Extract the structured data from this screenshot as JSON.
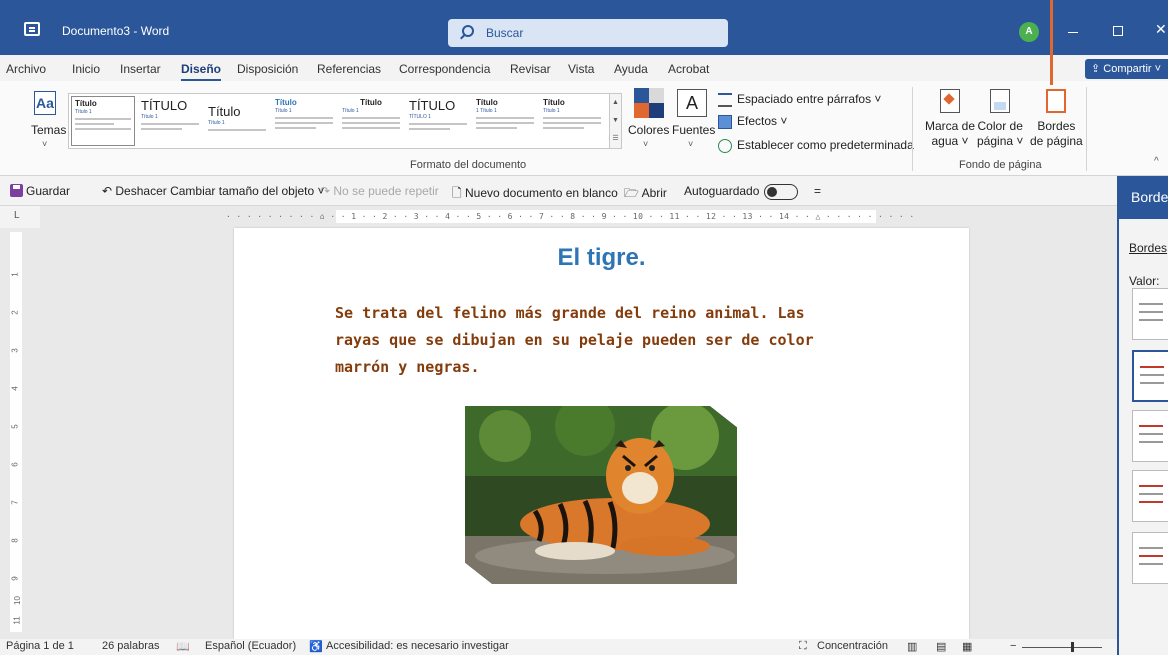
{
  "window": {
    "title": "Documento3 - Word",
    "search_placeholder": "Buscar",
    "avatar_initial": "A"
  },
  "menu_tabs": [
    {
      "label": "Archivo"
    },
    {
      "label": "Inicio"
    },
    {
      "label": "Insertar"
    },
    {
      "label": "Diseño",
      "active": true
    },
    {
      "label": "Disposición"
    },
    {
      "label": "Referencias"
    },
    {
      "label": "Correspondencia"
    },
    {
      "label": "Revisar"
    },
    {
      "label": "Vista"
    },
    {
      "label": "Ayuda"
    },
    {
      "label": "Acrobat"
    }
  ],
  "share_label": "Compartir",
  "ribbon": {
    "temas_label": "Temas",
    "style_gallery": [
      {
        "heading": "Título",
        "sub": "Título 1"
      },
      {
        "heading": "TÍTULO",
        "sub": "Título 1"
      },
      {
        "heading": "Título",
        "sub": "Título 1"
      },
      {
        "heading": "Título",
        "sub": "Título 1"
      },
      {
        "heading": "Título",
        "sub": "Título 1"
      },
      {
        "heading": "TÍTULO",
        "sub": "TÍTULO 1"
      },
      {
        "heading": "Título",
        "sub": "1 Título 1"
      },
      {
        "heading": "Título",
        "sub": "Título 1"
      }
    ],
    "colores_label": "Colores",
    "fuentes_label": "Fuentes",
    "fuentes_glyph": "A",
    "espaciado_label": "Espaciado entre párrafos ˅",
    "efectos_label": "Efectos ˅",
    "predeterminada_label": "Establecer como predeterminada",
    "formato_group_label": "Formato del documento",
    "marca_agua_label_1": "Marca de",
    "marca_agua_label_2": "agua ˅",
    "color_pagina_label_1": "Color de",
    "color_pagina_label_2": "página ˅",
    "bordes_pagina_label_1": "Bordes",
    "bordes_pagina_label_2": "de página",
    "fondo_group_label": "Fondo de página"
  },
  "qat": {
    "guardar": "Guardar",
    "deshacer": "Deshacer Cambiar tamaño del objeto",
    "rehacer": "No se puede repetir",
    "nuevo": "Nuevo documento en blanco",
    "abrir": "Abrir",
    "autoguardado": "Autoguardado"
  },
  "ruler": {
    "corner": "L",
    "horizontal_ticks": "· · · · · · · · · ⌂ · · 1 · · 2 · · 3 · · 4 · · 5 · · 6 · · 7 · · 8 · · 9 · · 10 · · 11 · · 12 · · 13 · · 14 · · △ · · · · · · · · ·",
    "vertical_numbers": [
      "1",
      "2",
      "3",
      "4",
      "5",
      "6",
      "7",
      "8",
      "9",
      "10",
      "11"
    ]
  },
  "document": {
    "title": "El tigre.",
    "body": "Se trata del felino más grande del reino animal. Las rayas que se dibujan en su pelaje pueden ser de color marrón y negras."
  },
  "status": {
    "page": "Página 1 de 1",
    "words": "26 palabras",
    "language": "Español (Ecuador)",
    "accessibility": "Accesibilidad: es necesario investigar",
    "focus": "Concentración"
  },
  "side_pane": {
    "title": "Bordes y sombreado",
    "tab": "Bordes",
    "section_label": "Valor:"
  },
  "colors": {
    "word_blue": "#2b579a",
    "title_blue": "#2e75b6",
    "body_brown": "#843c0c",
    "pointer_orange": "#e0672f"
  }
}
